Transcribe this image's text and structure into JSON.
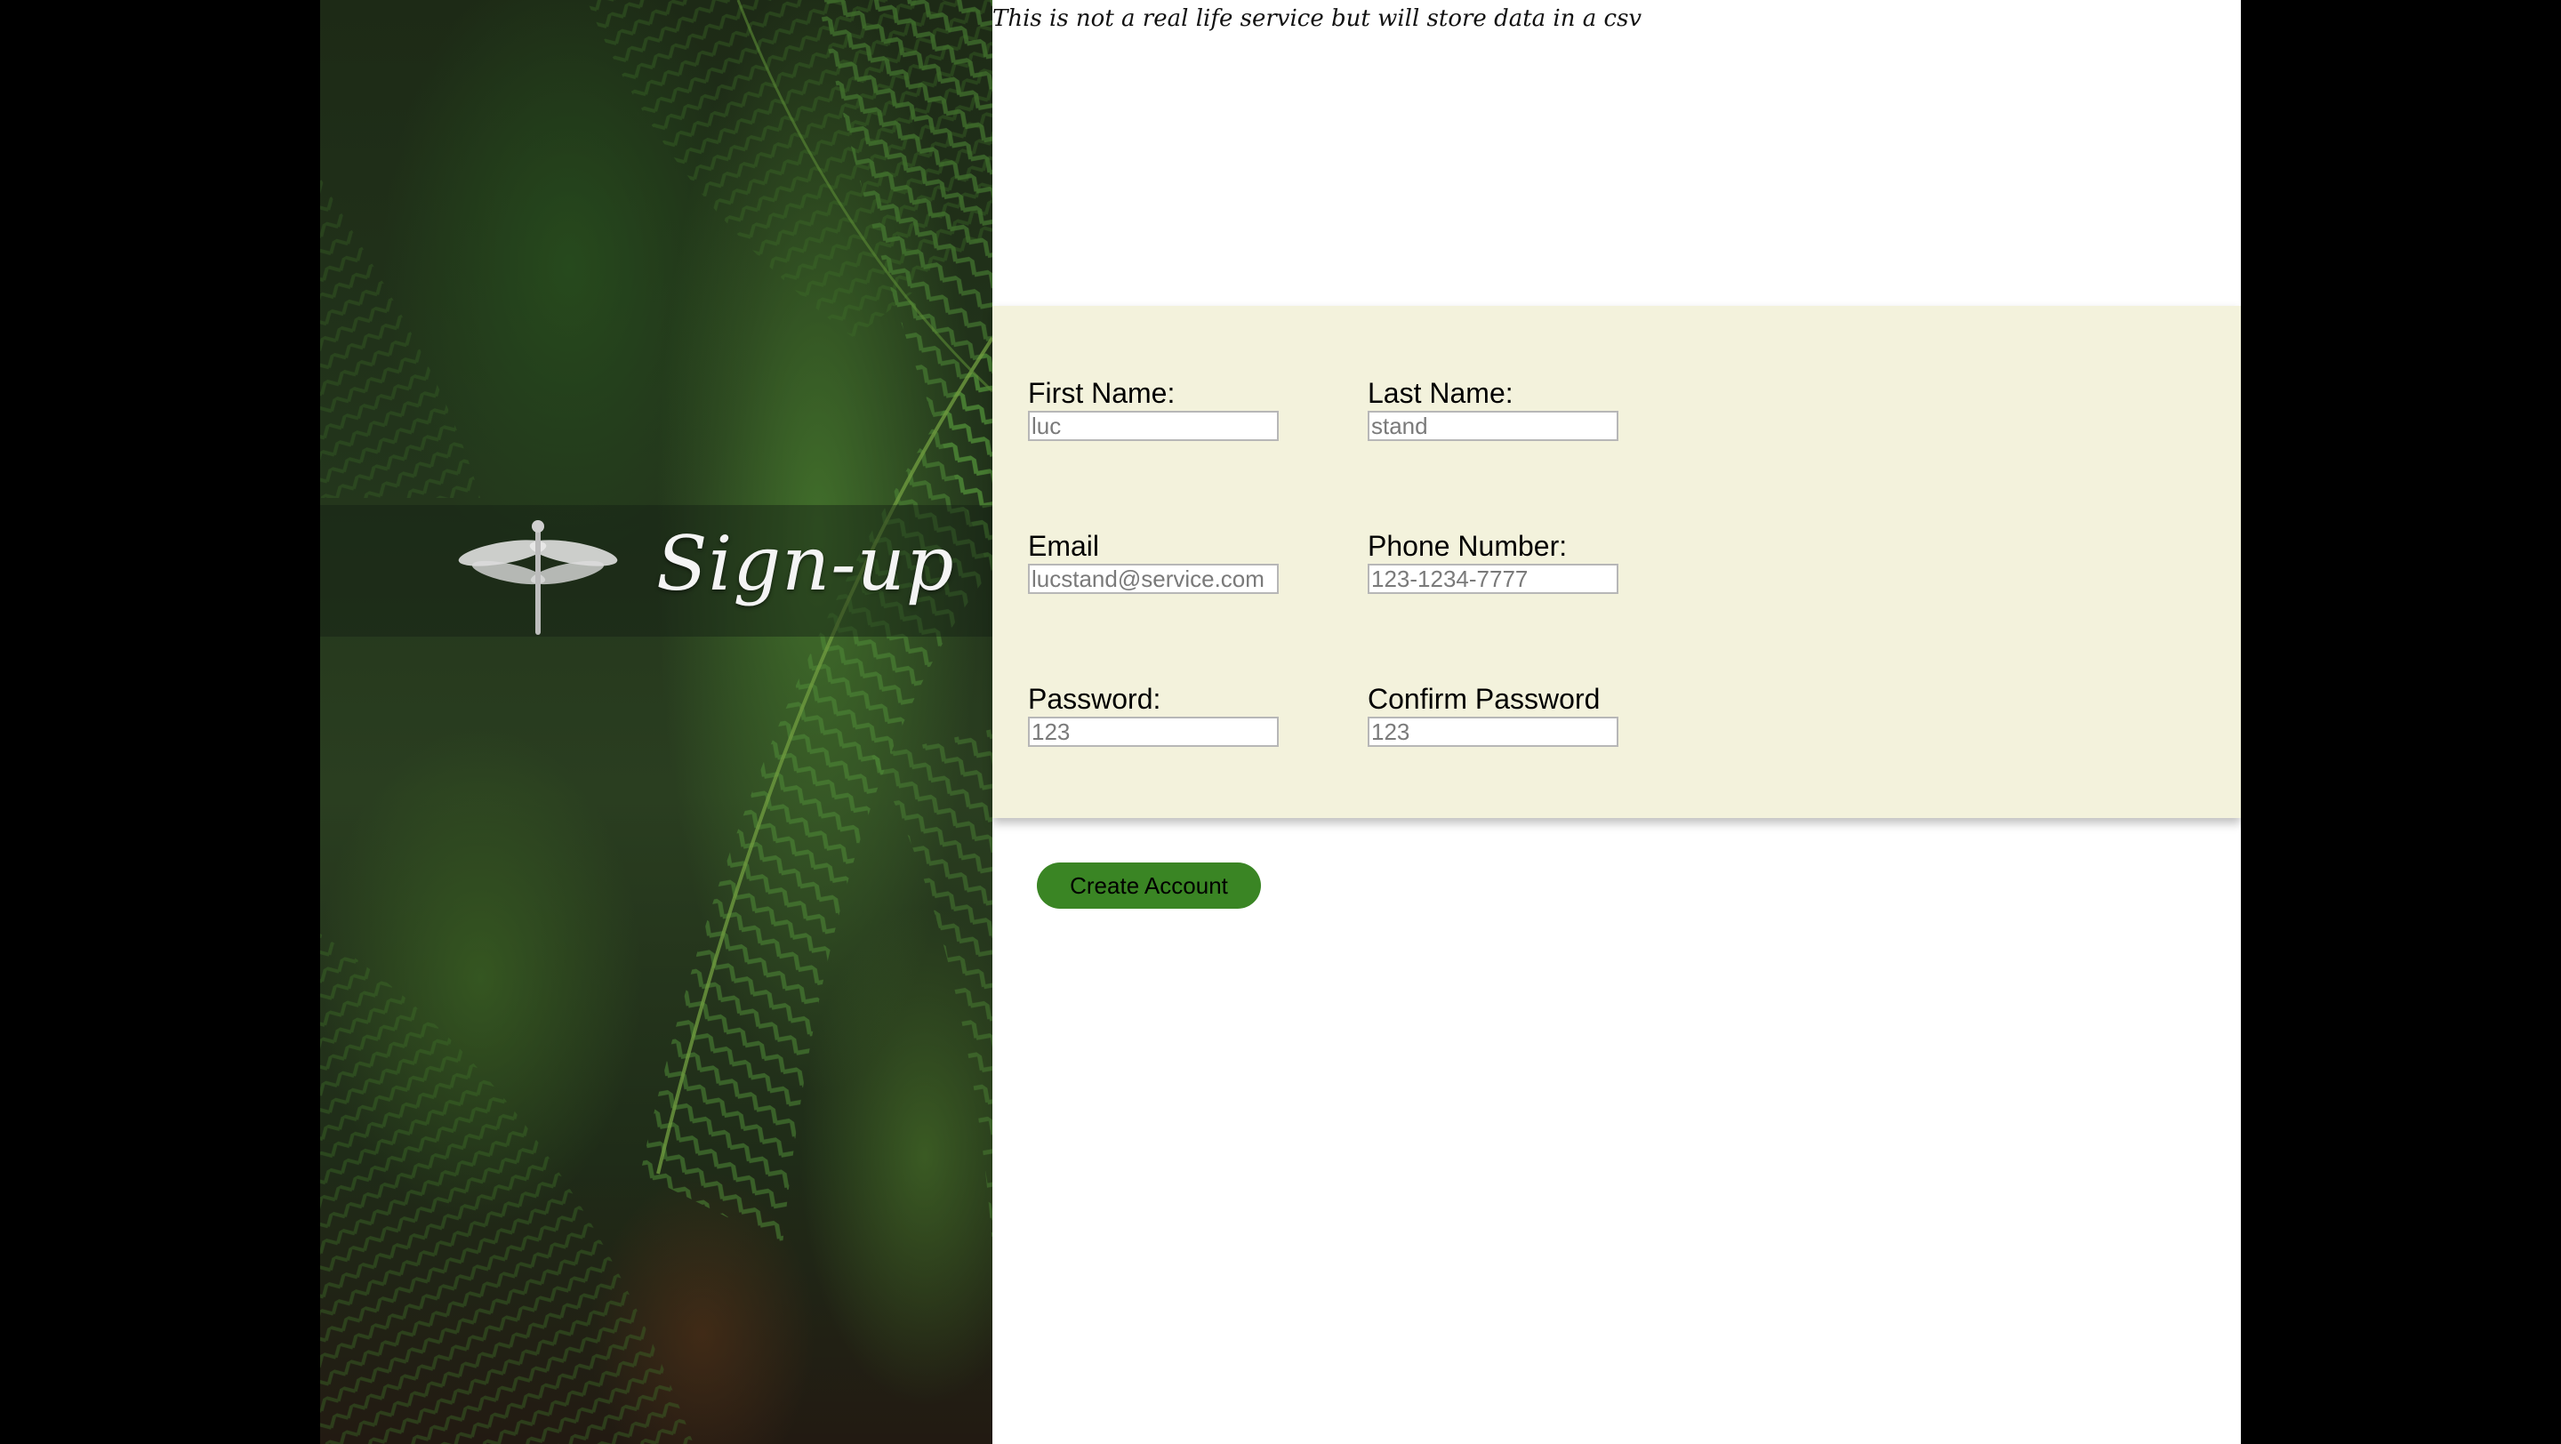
{
  "disclaimer": "This is not a real life service but will store data in a csv",
  "hero": {
    "title": "Sign-up",
    "logo_icon": "dragonfly-icon"
  },
  "form": {
    "first_name": {
      "label": "First Name:",
      "placeholder": "luc"
    },
    "last_name": {
      "label": "Last Name:",
      "placeholder": "stand"
    },
    "email": {
      "label": "Email",
      "placeholder": "lucstand@service.com"
    },
    "phone": {
      "label": "Phone Number:",
      "placeholder": "123-1234-7777"
    },
    "password": {
      "label": "Password:",
      "placeholder": "123"
    },
    "confirm_password": {
      "label": "Confirm Password",
      "placeholder": "123"
    }
  },
  "actions": {
    "create_account_label": "Create Account"
  },
  "colors": {
    "form_background": "#f3f2dc",
    "button": "#3a8524",
    "page_margin": "#000000"
  }
}
